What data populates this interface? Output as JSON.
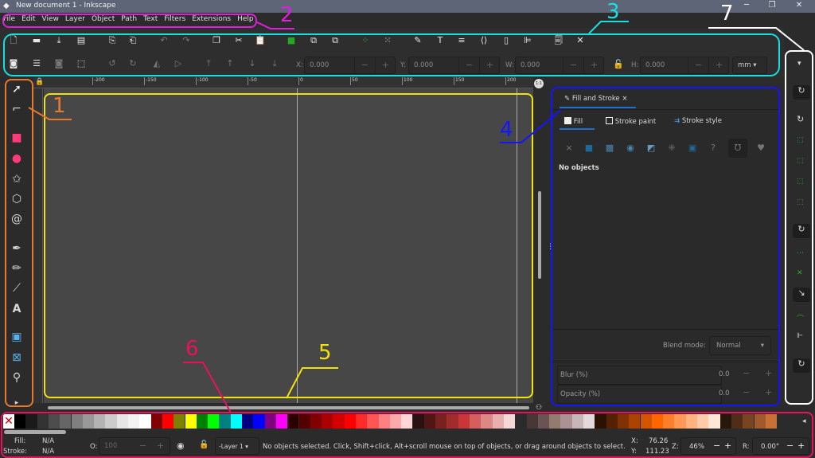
{
  "window": {
    "title": "New document 1 - Inkscape",
    "minimize": "─",
    "maximize": "❐",
    "close": "✕"
  },
  "menu": [
    "File",
    "Edit",
    "View",
    "Layer",
    "Object",
    "Path",
    "Text",
    "Filters",
    "Extensions",
    "Help"
  ],
  "toolbar": {
    "x_label": "X:",
    "x_value": "0.000",
    "y_label": "Y:",
    "y_value": "0.000",
    "w_label": "W:",
    "w_value": "0.000",
    "h_label": "H:",
    "h_value": "0.000",
    "unit": "mm",
    "minus": "−",
    "plus": "+"
  },
  "ruler": {
    "h_labels": [
      "-200",
      "-150",
      "-100",
      "-50",
      "0",
      "50",
      "100",
      "150",
      "200"
    ],
    "zoom_badge": "1:1"
  },
  "panel": {
    "tab": "Fill and Stroke",
    "close": "×",
    "subtabs": [
      "Fill",
      "Stroke paint",
      "Stroke style"
    ],
    "status": "No objects",
    "blend_label": "Blend mode:",
    "blend_value": "Normal",
    "blur_label": "Blur (%)",
    "blur_value": "0.0",
    "opacity_label": "Opacity (%)",
    "opacity_value": "0.0",
    "paint_help": "?"
  },
  "palette": {
    "colors": [
      "#000000",
      "#1a1a1a",
      "#333333",
      "#4d4d4d",
      "#666666",
      "#808080",
      "#999999",
      "#b3b3b3",
      "#cccccc",
      "#e6e6e6",
      "#f2f2f2",
      "#ffffff",
      "#800000",
      "#ff0000",
      "#808000",
      "#ffff00",
      "#008000",
      "#00ff00",
      "#008080",
      "#00ffff",
      "#000080",
      "#0000ff",
      "#800080",
      "#ff00ff",
      "#2b0000",
      "#550000",
      "#800000",
      "#aa0000",
      "#d40000",
      "#ff0000",
      "#ff2a2a",
      "#ff5555",
      "#ff8080",
      "#ffaaaa",
      "#ffd5d5",
      "#2b1111",
      "#501616",
      "#782121",
      "#a02c2c",
      "#c83737",
      "#d35f5f",
      "#de8787",
      "#e9afaf",
      "#f4d7d7",
      "#2b2b2b",
      "#483737",
      "#6c5353",
      "#917c6f",
      "#ac9393",
      "#c8b7b7",
      "#e3dbdb",
      "#2b1100",
      "#552200",
      "#803300",
      "#aa4400",
      "#d45500",
      "#ff6600",
      "#ff7f2a",
      "#ff9955",
      "#ffb380",
      "#ffccaa",
      "#ffe6d5",
      "#28170b",
      "#502d16",
      "#784421",
      "#a05a2c",
      "#c87137"
    ]
  },
  "status": {
    "fill_label": "Fill:",
    "fill_value": "N/A",
    "stroke_label": "Stroke:",
    "stroke_value": "N/A",
    "opacity_label": "O:",
    "opacity_value": "100",
    "layer": "-Layer 1",
    "message": "No objects selected. Click, Shift+click, Alt+scroll mouse on top of objects, or drag around objects to select.",
    "x_label": "X:",
    "x_value": "76.26",
    "y_label": "Y:",
    "y_value": "111.23",
    "zoom_label": "Z:",
    "zoom_value": "46%",
    "rotate_label": "R:",
    "rotate_value": "0.00°"
  },
  "annotations": [
    {
      "n": "1",
      "color": "#e8782e"
    },
    {
      "n": "2",
      "color": "#e01ee0"
    },
    {
      "n": "3",
      "color": "#18e0e0"
    },
    {
      "n": "4",
      "color": "#1414ff"
    },
    {
      "n": "5",
      "color": "#f2e20c"
    },
    {
      "n": "6",
      "color": "#e8125c"
    },
    {
      "n": "7",
      "color": "#ffffff"
    }
  ]
}
